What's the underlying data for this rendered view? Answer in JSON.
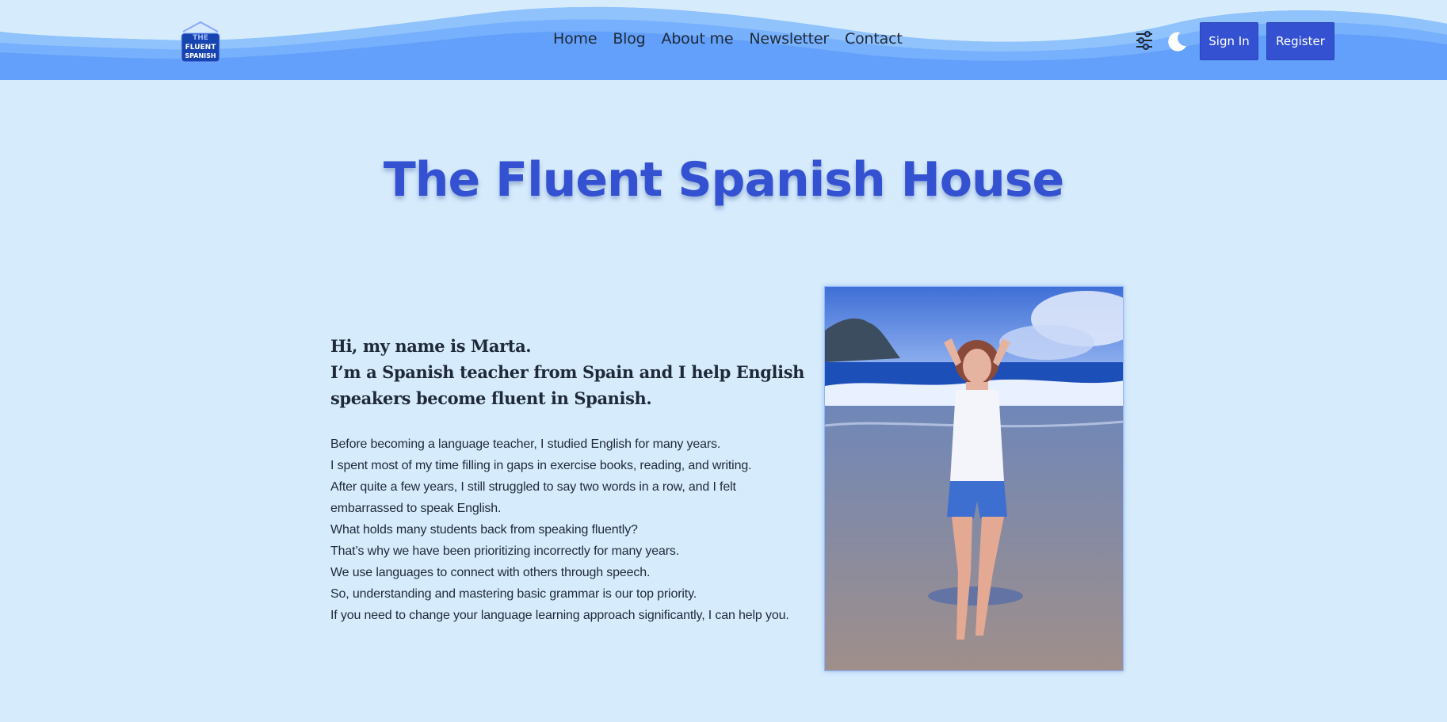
{
  "header": {
    "logo_text": [
      "THE",
      "FLUENT",
      "SPANISH"
    ],
    "nav": [
      {
        "label": "Home"
      },
      {
        "label": "Blog"
      },
      {
        "label": "About me"
      },
      {
        "label": "Newsletter"
      },
      {
        "label": "Contact"
      }
    ],
    "icons": {
      "settings": "sliders-icon",
      "theme": "moon-icon"
    },
    "sign_in_label": "Sign In",
    "register_label": "Register"
  },
  "main": {
    "title": "The Fluent Spanish House",
    "intro_heading": [
      "Hi, my name is Marta.",
      "I’m a Spanish teacher from Spain and I help English",
      "speakers become fluent in Spanish."
    ],
    "intro_body": [
      "Before becoming a language teacher, I studied English for many years.",
      "I spent most of my time filling in gaps in exercise books, reading, and writing.",
      "After quite a few years, I still struggled to say two words in a row, and I felt",
      "embarrassed to speak English.",
      "What holds many students back from speaking fluently?",
      "That’s why we have been prioritizing incorrectly for many years.",
      "We use languages to connect with others through speech.",
      "So, understanding and mastering basic grammar is our top priority.",
      "If you need to change your language learning approach significantly, I can help you."
    ]
  },
  "colors": {
    "background": "#d6ecfd",
    "header": "#62a0fb",
    "accent": "#3451d1"
  }
}
